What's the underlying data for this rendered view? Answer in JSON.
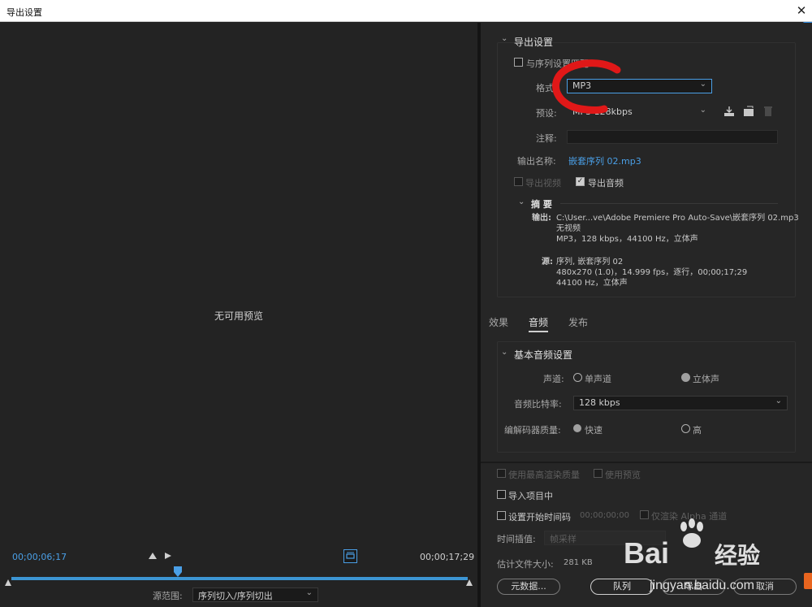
{
  "window": {
    "title": "导出设置",
    "close_glyph": "✕"
  },
  "preview": {
    "message": "无可用预览",
    "timecode_current": "00;00;06;17",
    "timecode_end": "00;00;17;29",
    "source_range_label": "源范围:",
    "source_range_value": "序列切入/序列切出",
    "accent_color": "#3c95d3"
  },
  "export_settings": {
    "header": "导出设置",
    "match_sequence_label": "与序列设置匹配",
    "format_label": "格式:",
    "format_value": "MP3",
    "preset_label": "预设:",
    "preset_value": "MP3 128kbps",
    "comment_label": "注释:",
    "output_name_label": "输出名称:",
    "output_name_value": "嵌套序列 02.mp3",
    "export_video_label": "导出视频",
    "export_audio_label": "导出音频",
    "summary": {
      "header": "摘 要",
      "output_label": "输出:",
      "output_lines": [
        "C:\\User...ve\\Adobe Premiere Pro Auto-Save\\嵌套序列 02.mp3",
        "无视频",
        "MP3，128 kbps，44100 Hz，立体声"
      ],
      "source_label": "源:",
      "source_lines": [
        "序列, 嵌套序列 02",
        "480x270 (1.0)，14.999 fps，逐行，00;00;17;29",
        "44100 Hz，立体声"
      ]
    }
  },
  "tabs": {
    "effects": "效果",
    "audio": "音频",
    "publish": "发布"
  },
  "audio_settings": {
    "header": "基本音频设置",
    "channels_label": "声道:",
    "mono_label": "单声道",
    "stereo_label": "立体声",
    "bitrate_label": "音频比特率:",
    "bitrate_value": "128 kbps",
    "codec_quality_label": "编解码器质量:",
    "fast_label": "快速",
    "high_label": "高"
  },
  "bottom": {
    "max_render_label": "使用最高渲染质量",
    "use_preview_label": "使用预览",
    "import_label": "导入项目中",
    "start_tc_label": "设置开始时间码",
    "start_tc_value": "00;00;00;00",
    "alpha_label": "仅渲染 Alpha 通道",
    "time_interp_label": "时间插值:",
    "time_interp_value": "帧采样",
    "filesize_label": "估计文件大小:",
    "filesize_value": "281 KB",
    "metadata_button": "元数据...",
    "queue_button": "队列",
    "export_button": "导出",
    "cancel_button": "取消"
  },
  "watermark": {
    "brand": "Bai",
    "brand_cn": "经验",
    "url": "jingyan.baidu.com"
  }
}
